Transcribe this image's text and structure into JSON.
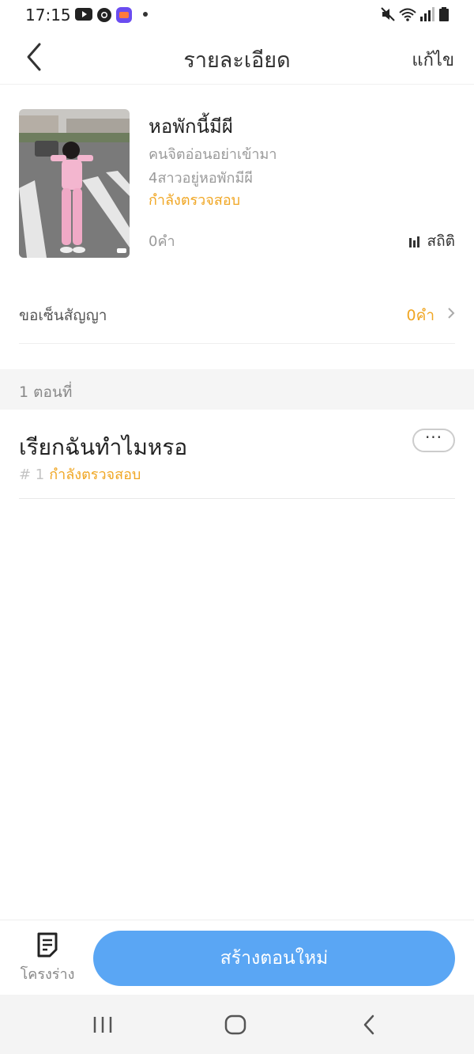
{
  "status_bar": {
    "time": "17:15",
    "icons": [
      "youtube-icon",
      "chrome-icon",
      "app-icon",
      "dot-icon",
      "mute-icon",
      "wifi-icon",
      "signal-icon",
      "battery-icon"
    ]
  },
  "header": {
    "title": "รายละเอียด",
    "edit_label": "แก้ไข",
    "back_icon": "chevron-left-icon"
  },
  "book": {
    "title": "หอพักนี้มีผี",
    "subtitle": "คนจิตอ่อนอย่าเข้ามา",
    "tagline": "4สาวอยู่หอพักมีผี",
    "status": "กำลังตรวจสอบ",
    "words": "0คำ",
    "stats_label": "สถิติ",
    "cover_icon": "cover-image"
  },
  "contract": {
    "label": "ขอเซ็นสัญญา",
    "value": "0คำ"
  },
  "chapters_header": "1 ตอนที่",
  "chapters": [
    {
      "title": "เรียกฉันทำไมหรอ",
      "number": "# 1",
      "status": "กำลังตรวจสอบ",
      "more_label": "···"
    }
  ],
  "bottom_bar": {
    "draft_label": "โครงร่าง",
    "create_label": "สร้างตอนใหม่"
  },
  "colors": {
    "accent_orange": "#f0a623",
    "primary_blue": "#5aa6f4"
  }
}
